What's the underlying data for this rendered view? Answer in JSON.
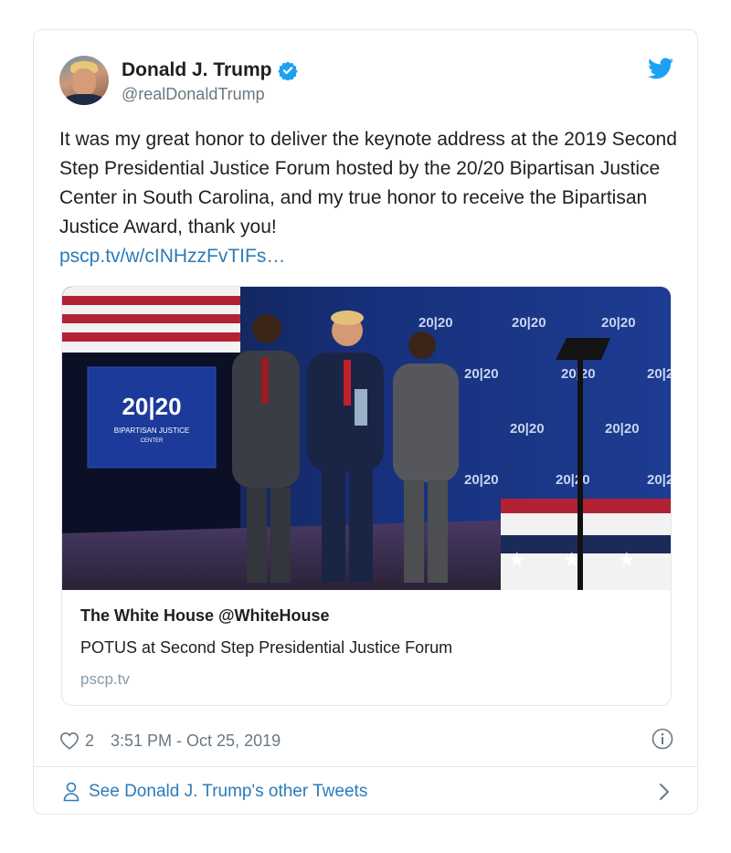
{
  "tweet": {
    "author_name": "Donald J. Trump",
    "author_handle": "@realDonaldTrump",
    "text": "It was my great honor to deliver the keynote address at the 2019 Second Step Presidential Justice Forum hosted by the 20/20 Bipartisan Justice Center in South Carolina, and my true honor to receive the Bipartisan Justice Award, thank you!",
    "link": "pscp.tv/w/cINHzzFvTIFs…",
    "likes": "2",
    "timestamp": "3:51 PM - Oct 25, 2019"
  },
  "media_card": {
    "title": "The White House @WhiteHouse",
    "description": "POTUS at Second Step Presidential Justice Forum",
    "domain": "pscp.tv",
    "sign_text_main": "20|20",
    "sign_text_sub": "BIPARTISAN JUSTICE",
    "sign_text_sub2": "CENTER"
  },
  "footer": {
    "see_more": "See Donald J. Trump's other Tweets"
  },
  "icons": {
    "verified": "verified-badge-icon",
    "bird": "twitter-bird-icon",
    "heart": "heart-icon",
    "info": "info-icon",
    "person": "person-icon",
    "chevron": "chevron-right-icon"
  },
  "colors": {
    "link": "#2b7bb9",
    "verified": "#1da1f2",
    "muted": "#697882",
    "border": "#e1e8ed"
  }
}
